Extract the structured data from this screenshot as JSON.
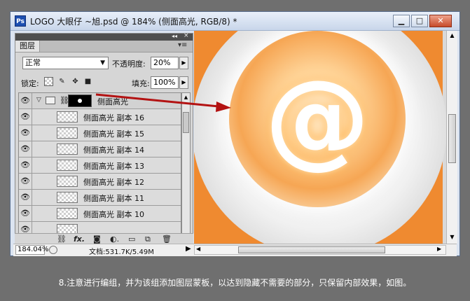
{
  "window": {
    "title": "LOGO 大眼仔 ~旭.psd @ 184% (侧面高光, RGB/8) *",
    "app_icon": "Ps",
    "buttons": {
      "minimize": "▁",
      "maximize": "□",
      "close": "✕"
    }
  },
  "layers_panel": {
    "tab": "图层",
    "blend_mode": "正常",
    "opacity_label": "不透明度:",
    "opacity_value": "20%",
    "lock_label": "锁定:",
    "fill_label": "填充:",
    "fill_value": "100%",
    "group": {
      "name": "侧面高光"
    },
    "layers": [
      {
        "name": "侧面高光 副本 16"
      },
      {
        "name": "侧面高光 副本 15"
      },
      {
        "name": "侧面高光 副本 14"
      },
      {
        "name": "侧面高光 副本 13"
      },
      {
        "name": "侧面高光 副本 12"
      },
      {
        "name": "侧面高光 副本 11"
      },
      {
        "name": "侧面高光 副本 10"
      }
    ]
  },
  "canvas": {
    "glyph": "@",
    "background_color": "#ef8a30"
  },
  "status": {
    "zoom": "184.04%",
    "doc_info": "文档:531.7K/5.49M"
  },
  "caption": "8.注意进行编组，并为该组添加图层蒙板，以达到隐藏不需要的部分，只保留内部效果，如图。"
}
